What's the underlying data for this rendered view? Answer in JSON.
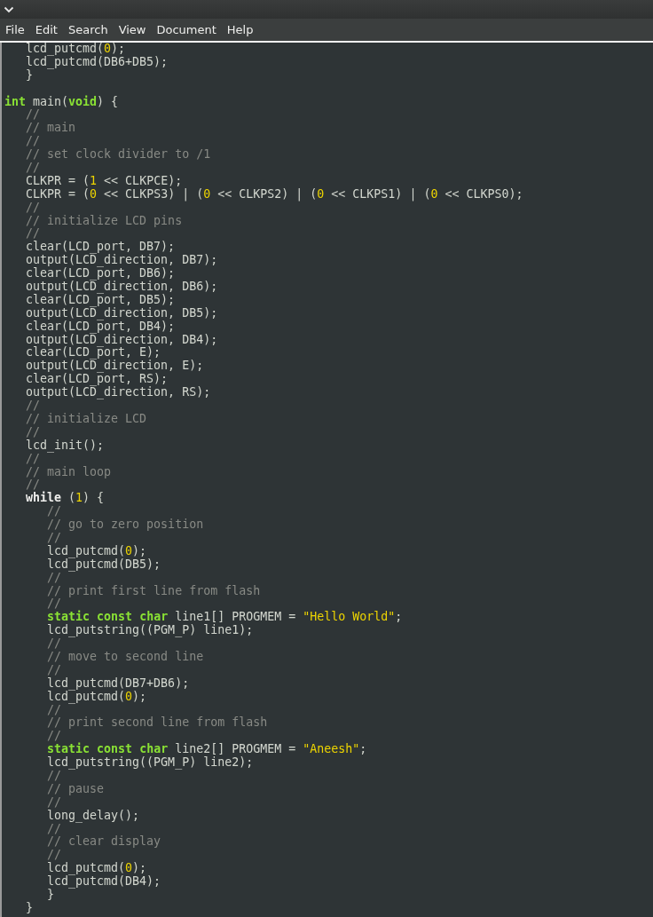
{
  "menu": [
    "File",
    "Edit",
    "Search",
    "View",
    "Document",
    "Help"
  ],
  "code_lines": [
    {
      "kind": "code",
      "tokens": [
        {
          "kind": "plain",
          "text": "   lcd_putcmd("
        },
        {
          "kind": "number",
          "text": "0"
        },
        {
          "kind": "plain",
          "text": ");"
        }
      ]
    },
    {
      "kind": "code",
      "tokens": [
        {
          "kind": "plain",
          "text": "   lcd_putcmd(DB6+DB5);"
        }
      ]
    },
    {
      "kind": "code",
      "tokens": [
        {
          "kind": "plain",
          "text": "   }"
        }
      ]
    },
    {
      "kind": "blank"
    },
    {
      "kind": "code",
      "tokens": [
        {
          "kind": "type",
          "text": "int"
        },
        {
          "kind": "plain",
          "text": " main("
        },
        {
          "kind": "type",
          "text": "void"
        },
        {
          "kind": "plain",
          "text": ") {"
        }
      ]
    },
    {
      "kind": "code",
      "tokens": [
        {
          "kind": "comment",
          "text": "   //"
        }
      ]
    },
    {
      "kind": "code",
      "tokens": [
        {
          "kind": "comment",
          "text": "   // main"
        }
      ]
    },
    {
      "kind": "code",
      "tokens": [
        {
          "kind": "comment",
          "text": "   //"
        }
      ]
    },
    {
      "kind": "code",
      "tokens": [
        {
          "kind": "comment",
          "text": "   // set clock divider to /1"
        }
      ]
    },
    {
      "kind": "code",
      "tokens": [
        {
          "kind": "comment",
          "text": "   //"
        }
      ]
    },
    {
      "kind": "code",
      "tokens": [
        {
          "kind": "plain",
          "text": "   CLKPR = ("
        },
        {
          "kind": "number",
          "text": "1"
        },
        {
          "kind": "plain",
          "text": " << CLKPCE);"
        }
      ]
    },
    {
      "kind": "code",
      "tokens": [
        {
          "kind": "plain",
          "text": "   CLKPR = ("
        },
        {
          "kind": "number",
          "text": "0"
        },
        {
          "kind": "plain",
          "text": " << CLKPS3) | ("
        },
        {
          "kind": "number",
          "text": "0"
        },
        {
          "kind": "plain",
          "text": " << CLKPS2) | ("
        },
        {
          "kind": "number",
          "text": "0"
        },
        {
          "kind": "plain",
          "text": " << CLKPS1) | ("
        },
        {
          "kind": "number",
          "text": "0"
        },
        {
          "kind": "plain",
          "text": " << CLKPS0);"
        }
      ]
    },
    {
      "kind": "code",
      "tokens": [
        {
          "kind": "comment",
          "text": "   //"
        }
      ]
    },
    {
      "kind": "code",
      "tokens": [
        {
          "kind": "comment",
          "text": "   // initialize LCD pins"
        }
      ]
    },
    {
      "kind": "code",
      "tokens": [
        {
          "kind": "comment",
          "text": "   //"
        }
      ]
    },
    {
      "kind": "code",
      "tokens": [
        {
          "kind": "plain",
          "text": "   clear(LCD_port, DB7);"
        }
      ]
    },
    {
      "kind": "code",
      "tokens": [
        {
          "kind": "plain",
          "text": "   output(LCD_direction, DB7);"
        }
      ]
    },
    {
      "kind": "code",
      "tokens": [
        {
          "kind": "plain",
          "text": "   clear(LCD_port, DB6);"
        }
      ]
    },
    {
      "kind": "code",
      "tokens": [
        {
          "kind": "plain",
          "text": "   output(LCD_direction, DB6);"
        }
      ]
    },
    {
      "kind": "code",
      "tokens": [
        {
          "kind": "plain",
          "text": "   clear(LCD_port, DB5);"
        }
      ]
    },
    {
      "kind": "code",
      "tokens": [
        {
          "kind": "plain",
          "text": "   output(LCD_direction, DB5);"
        }
      ]
    },
    {
      "kind": "code",
      "tokens": [
        {
          "kind": "plain",
          "text": "   clear(LCD_port, DB4);"
        }
      ]
    },
    {
      "kind": "code",
      "tokens": [
        {
          "kind": "plain",
          "text": "   output(LCD_direction, DB4);"
        }
      ]
    },
    {
      "kind": "code",
      "tokens": [
        {
          "kind": "plain",
          "text": "   clear(LCD_port, E);"
        }
      ]
    },
    {
      "kind": "code",
      "tokens": [
        {
          "kind": "plain",
          "text": "   output(LCD_direction, E);"
        }
      ]
    },
    {
      "kind": "code",
      "tokens": [
        {
          "kind": "plain",
          "text": "   clear(LCD_port, RS);"
        }
      ]
    },
    {
      "kind": "code",
      "tokens": [
        {
          "kind": "plain",
          "text": "   output(LCD_direction, RS);"
        }
      ]
    },
    {
      "kind": "code",
      "tokens": [
        {
          "kind": "comment",
          "text": "   //"
        }
      ]
    },
    {
      "kind": "code",
      "tokens": [
        {
          "kind": "comment",
          "text": "   // initialize LCD"
        }
      ]
    },
    {
      "kind": "code",
      "tokens": [
        {
          "kind": "comment",
          "text": "   //"
        }
      ]
    },
    {
      "kind": "code",
      "tokens": [
        {
          "kind": "plain",
          "text": "   lcd_init();"
        }
      ]
    },
    {
      "kind": "code",
      "tokens": [
        {
          "kind": "comment",
          "text": "   //"
        }
      ]
    },
    {
      "kind": "code",
      "tokens": [
        {
          "kind": "comment",
          "text": "   // main loop"
        }
      ]
    },
    {
      "kind": "code",
      "tokens": [
        {
          "kind": "comment",
          "text": "   //"
        }
      ]
    },
    {
      "kind": "code",
      "tokens": [
        {
          "kind": "keyword",
          "text": "   while"
        },
        {
          "kind": "plain",
          "text": " ("
        },
        {
          "kind": "number",
          "text": "1"
        },
        {
          "kind": "plain",
          "text": ") {"
        }
      ]
    },
    {
      "kind": "code",
      "tokens": [
        {
          "kind": "comment",
          "text": "      //"
        }
      ]
    },
    {
      "kind": "code",
      "tokens": [
        {
          "kind": "comment",
          "text": "      // go to zero position"
        }
      ]
    },
    {
      "kind": "code",
      "tokens": [
        {
          "kind": "comment",
          "text": "      //"
        }
      ]
    },
    {
      "kind": "code",
      "tokens": [
        {
          "kind": "plain",
          "text": "      lcd_putcmd("
        },
        {
          "kind": "number",
          "text": "0"
        },
        {
          "kind": "plain",
          "text": ");"
        }
      ]
    },
    {
      "kind": "code",
      "tokens": [
        {
          "kind": "plain",
          "text": "      lcd_putcmd(DB5);"
        }
      ]
    },
    {
      "kind": "code",
      "tokens": [
        {
          "kind": "comment",
          "text": "      //"
        }
      ]
    },
    {
      "kind": "code",
      "tokens": [
        {
          "kind": "comment",
          "text": "      // print first line from flash"
        }
      ]
    },
    {
      "kind": "code",
      "tokens": [
        {
          "kind": "comment",
          "text": "      //"
        }
      ]
    },
    {
      "kind": "code",
      "tokens": [
        {
          "kind": "type",
          "text": "      static"
        },
        {
          "kind": "type",
          "text": " const"
        },
        {
          "kind": "type",
          "text": " char"
        },
        {
          "kind": "plain",
          "text": " line1[] PROGMEM = "
        },
        {
          "kind": "string",
          "text": "\"Hello World\""
        },
        {
          "kind": "plain",
          "text": ";"
        }
      ]
    },
    {
      "kind": "code",
      "tokens": [
        {
          "kind": "plain",
          "text": "      lcd_putstring((PGM_P) line1);"
        }
      ]
    },
    {
      "kind": "code",
      "tokens": [
        {
          "kind": "comment",
          "text": "      //"
        }
      ]
    },
    {
      "kind": "code",
      "tokens": [
        {
          "kind": "comment",
          "text": "      // move to second line"
        }
      ]
    },
    {
      "kind": "code",
      "tokens": [
        {
          "kind": "comment",
          "text": "      //"
        }
      ]
    },
    {
      "kind": "code",
      "tokens": [
        {
          "kind": "plain",
          "text": "      lcd_putcmd(DB7+DB6);"
        }
      ]
    },
    {
      "kind": "code",
      "tokens": [
        {
          "kind": "plain",
          "text": "      lcd_putcmd("
        },
        {
          "kind": "number",
          "text": "0"
        },
        {
          "kind": "plain",
          "text": ");"
        }
      ]
    },
    {
      "kind": "code",
      "tokens": [
        {
          "kind": "comment",
          "text": "      //"
        }
      ]
    },
    {
      "kind": "code",
      "tokens": [
        {
          "kind": "comment",
          "text": "      // print second line from flash"
        }
      ]
    },
    {
      "kind": "code",
      "tokens": [
        {
          "kind": "comment",
          "text": "      //"
        }
      ]
    },
    {
      "kind": "code",
      "tokens": [
        {
          "kind": "type",
          "text": "      static"
        },
        {
          "kind": "type",
          "text": " const"
        },
        {
          "kind": "type",
          "text": " char"
        },
        {
          "kind": "plain",
          "text": " line2[] PROGMEM = "
        },
        {
          "kind": "string",
          "text": "\"Aneesh\""
        },
        {
          "kind": "plain",
          "text": ";"
        }
      ]
    },
    {
      "kind": "code",
      "tokens": [
        {
          "kind": "plain",
          "text": "      lcd_putstring((PGM_P) line2);"
        }
      ]
    },
    {
      "kind": "code",
      "tokens": [
        {
          "kind": "comment",
          "text": "      //"
        }
      ]
    },
    {
      "kind": "code",
      "tokens": [
        {
          "kind": "comment",
          "text": "      // pause"
        }
      ]
    },
    {
      "kind": "code",
      "tokens": [
        {
          "kind": "comment",
          "text": "      //"
        }
      ]
    },
    {
      "kind": "code",
      "tokens": [
        {
          "kind": "plain",
          "text": "      long_delay();"
        }
      ]
    },
    {
      "kind": "code",
      "tokens": [
        {
          "kind": "comment",
          "text": "      //"
        }
      ]
    },
    {
      "kind": "code",
      "tokens": [
        {
          "kind": "comment",
          "text": "      // clear display"
        }
      ]
    },
    {
      "kind": "code",
      "tokens": [
        {
          "kind": "comment",
          "text": "      //"
        }
      ]
    },
    {
      "kind": "code",
      "tokens": [
        {
          "kind": "plain",
          "text": "      lcd_putcmd("
        },
        {
          "kind": "number",
          "text": "0"
        },
        {
          "kind": "plain",
          "text": ");"
        }
      ]
    },
    {
      "kind": "code",
      "tokens": [
        {
          "kind": "plain",
          "text": "      lcd_putcmd(DB4);"
        }
      ]
    },
    {
      "kind": "code",
      "tokens": [
        {
          "kind": "plain",
          "text": "      }"
        }
      ]
    },
    {
      "kind": "code",
      "tokens": [
        {
          "kind": "plain",
          "text": "   }"
        }
      ]
    }
  ]
}
